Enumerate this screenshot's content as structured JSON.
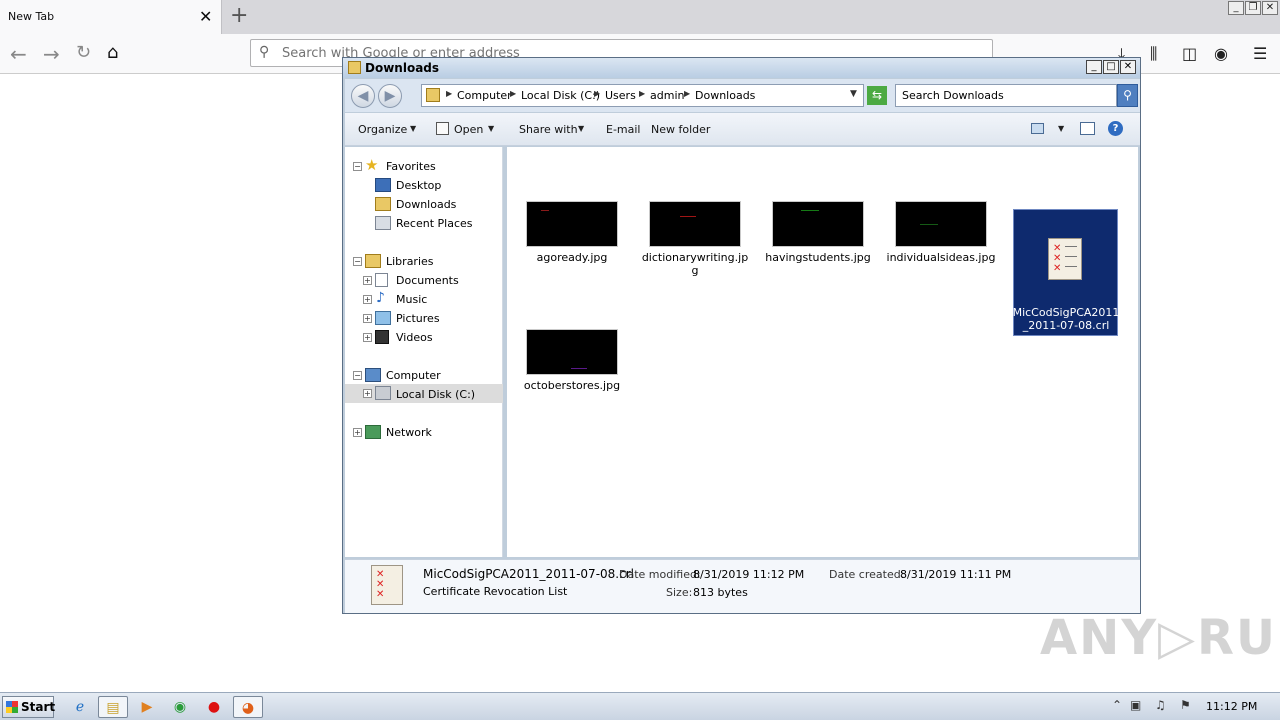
{
  "browser": {
    "tab_title": "New Tab",
    "tab_close": "✕",
    "new_tab": "+",
    "url_placeholder": "Search with Google or enter address",
    "window_buttons": [
      "_",
      "❐",
      "✕"
    ]
  },
  "explorer": {
    "title": "Downloads",
    "window_buttons": [
      "_",
      "□",
      "✕"
    ],
    "breadcrumb": [
      "Computer",
      "Local Disk (C:)",
      "Users",
      "admin",
      "Downloads"
    ],
    "search_placeholder": "Search Downloads",
    "commands": {
      "organize": "Organize",
      "open": "Open",
      "share_with": "Share with",
      "email": "E-mail",
      "new_folder": "New folder"
    },
    "nav_tree": {
      "favorites": "Favorites",
      "desktop": "Desktop",
      "downloads": "Downloads",
      "recent_places": "Recent Places",
      "libraries": "Libraries",
      "documents": "Documents",
      "music": "Music",
      "pictures": "Pictures",
      "videos": "Videos",
      "computer": "Computer",
      "local_disk": "Local Disk (C:)",
      "network": "Network"
    },
    "files": [
      {
        "name": "agoready.jpg",
        "mark_color": "#8a1a1a"
      },
      {
        "name": "dictionarywriting.jpg",
        "mark_color": "#a01515"
      },
      {
        "name": "havingstudents.jpg",
        "mark_color": "#157a15"
      },
      {
        "name": "individualsideas.jpg",
        "mark_color": "#155a15"
      },
      {
        "name": "MicCodSigPCA2011_2011-07-08.crl",
        "selected": true
      },
      {
        "name": "octoberstores.jpg",
        "mark_color": "#5a1a8a"
      }
    ],
    "file_label_lines": {
      "f1a": "dictionarywriting.jp",
      "f1b": "g",
      "f4a": "MicCodSigPCA2011",
      "f4b": "_2011-07-08.crl"
    },
    "details": {
      "filename": "MicCodSigPCA2011_2011-07-08.crl",
      "type": "Certificate Revocation List",
      "modified_label": "Date modified:",
      "modified_value": "8/31/2019 11:12 PM",
      "created_label": "Date created:",
      "created_value": "8/31/2019 11:11 PM",
      "size_label": "Size:",
      "size_value": "813 bytes"
    }
  },
  "watermark": "ANY▷RUN",
  "taskbar": {
    "start_label": "Start",
    "clock": "11:12 PM"
  }
}
